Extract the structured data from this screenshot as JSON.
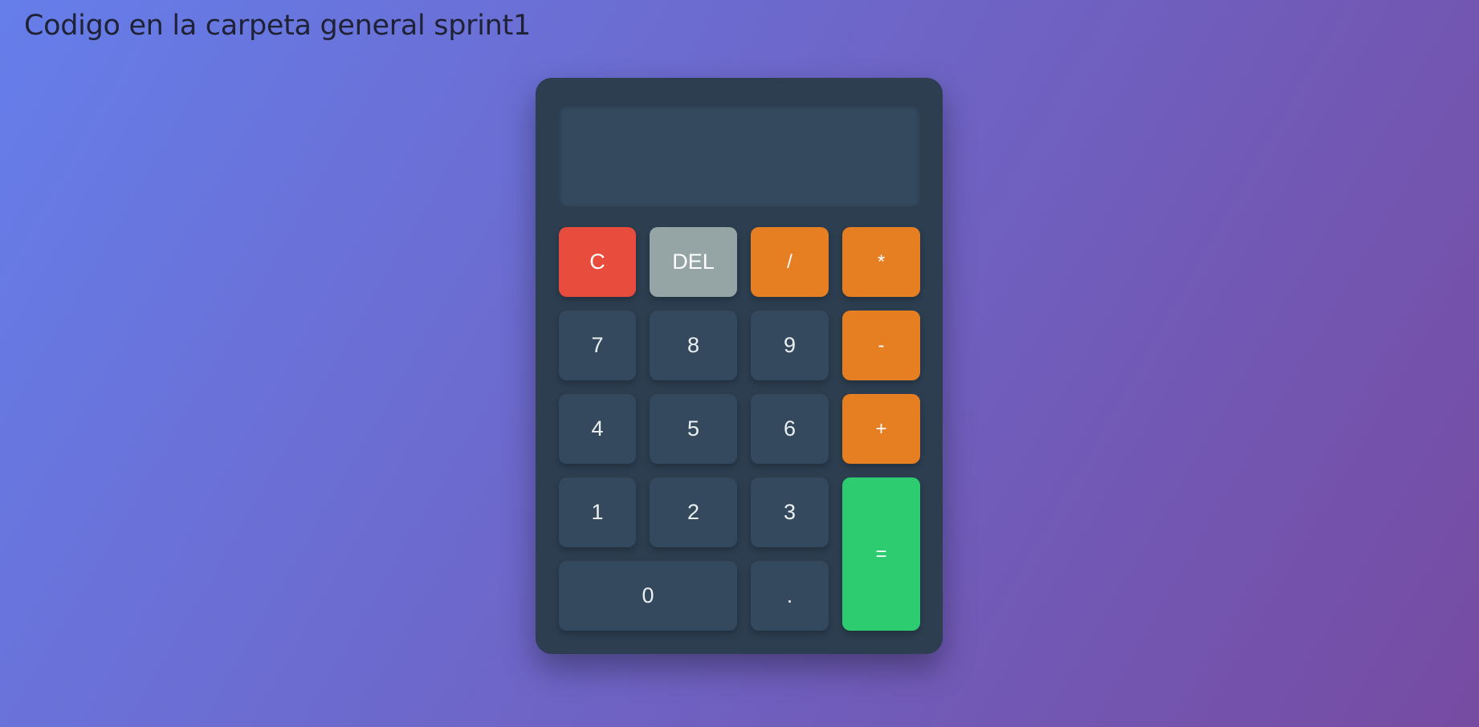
{
  "heading": "Codigo en la carpeta general sprint1",
  "display": {
    "value": ""
  },
  "keys": {
    "clear": "C",
    "delete": "DEL",
    "divide": "/",
    "multiply": "*",
    "seven": "7",
    "eight": "8",
    "nine": "9",
    "subtract": "-",
    "four": "4",
    "five": "5",
    "six": "6",
    "add": "+",
    "one": "1",
    "two": "2",
    "three": "3",
    "equals": "=",
    "zero": "0",
    "decimal": "."
  },
  "colors": {
    "background_start": "#667eea",
    "background_end": "#764ba2",
    "calculator_body": "#2c3e50",
    "display_and_number_keys": "#34495e",
    "clear_key": "#e74c3c",
    "delete_key": "#95a5a6",
    "operator_keys": "#e67e22",
    "equals_key": "#2ecc71"
  }
}
